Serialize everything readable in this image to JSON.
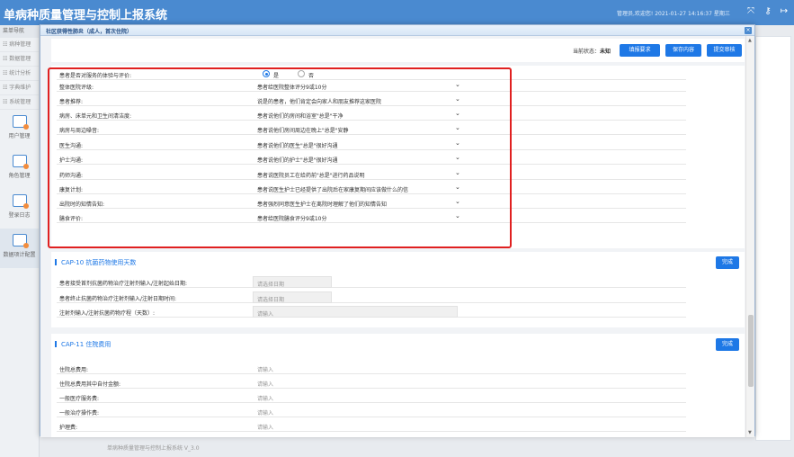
{
  "app": {
    "title": "单病种质量管理与控制上报系统",
    "user_info": "管理员,欢迎您!   2021-01-27 14:16:37 星期三"
  },
  "sidebar": {
    "header": "菜单导航",
    "items": [
      "病种管理",
      "数据管理",
      "统计分析",
      "字典维护",
      "系统管理"
    ],
    "tiles": [
      "用户管理",
      "角色管理",
      "登录日志",
      "数据项计配置"
    ]
  },
  "footer": "单病种质量管理与控制上报系统   V_3.0",
  "modal": {
    "title": "社区获得性肺炎（成人，首次住院）",
    "close": "×",
    "status_label": "当前状态：",
    "status_value": "未知",
    "buttons": {
      "fill_req": "填报要求",
      "save": "保存内容",
      "submit": "提交审核"
    }
  },
  "experience": {
    "rows": [
      {
        "label": "患者是否对服务的体验与评价:",
        "radio_yes": "是",
        "radio_no": "否"
      },
      {
        "label": "整体医院评级:",
        "value": "患者给医院整体评分9或10分"
      },
      {
        "label": "患者推荐:",
        "value": "说是的患者，他们肯定会向家人和朋友推荐这家医院"
      },
      {
        "label": "病房、床单元和卫生间清洁度:",
        "value": "患者说他们的房间和浴室\"总是\"干净"
      },
      {
        "label": "病房与周边噪音:",
        "value": "患者说他们房间周边在晚上\"总是\"安静"
      },
      {
        "label": "医生沟通:",
        "value": "患者说他们的医生\"总是\"很好沟通"
      },
      {
        "label": "护士沟通:",
        "value": "患者说他们的护士\"总是\"很好沟通"
      },
      {
        "label": "药师沟通:",
        "value": "患者说医院员工在给药前\"总是\"进行药品说明"
      },
      {
        "label": "康复计划:",
        "value": "患者说医生护士已经提供了出院后在家康复期间应该做什么的信"
      },
      {
        "label": "出院时的知情告知:",
        "value": "患者强烈同意医生护士在离院时理解了他们的知情告知"
      },
      {
        "label": "膳食评价:",
        "value": "患者给医院膳食评分9或10分"
      }
    ]
  },
  "cap10": {
    "title": "CAP-10 抗菌药物使用天数",
    "done": "完成",
    "rows": [
      {
        "label": "患者接受首剂抗菌药物治疗注射剂输入/注射起始日期:",
        "placeholder": "请选择日期"
      },
      {
        "label": "患者终止抗菌药物治疗注射剂输入/注射日期时间:",
        "placeholder": "请选择日期"
      },
      {
        "label": "注射剂输入/注射抗菌药物疗程（天数）:",
        "placeholder": "请输入"
      }
    ]
  },
  "cap11": {
    "title": "CAP-11 住院费用",
    "done": "完成",
    "rows": [
      {
        "label": "住院总费用:",
        "placeholder": "请输入"
      },
      {
        "label": "住院总费用其中自付金额:",
        "placeholder": "请输入"
      },
      {
        "label": "一般医疗服务费:",
        "placeholder": "请输入"
      },
      {
        "label": "一般治疗操作费:",
        "placeholder": "请输入"
      },
      {
        "label": "护理费:",
        "placeholder": "请输入"
      }
    ]
  },
  "colors": {
    "primary": "#1e78e6",
    "header": "#4a8ad0",
    "highlight": "#e02020"
  }
}
